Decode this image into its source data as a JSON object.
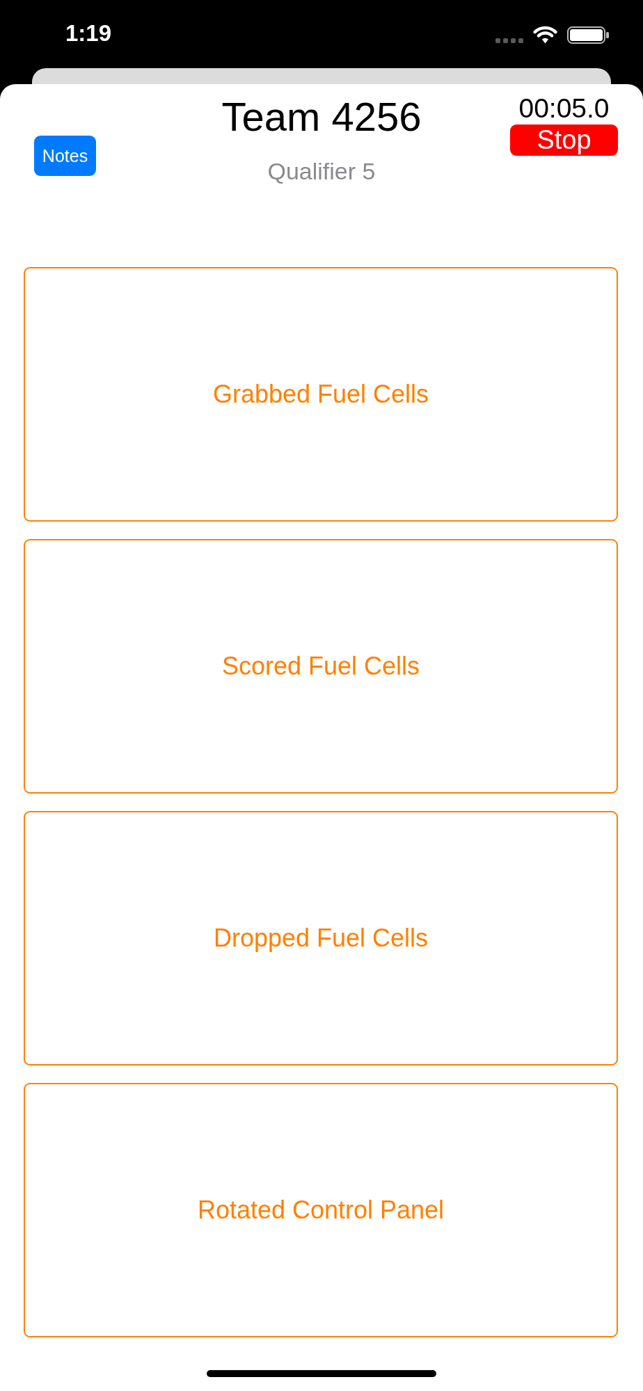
{
  "status_bar": {
    "time": "1:19"
  },
  "header": {
    "notes_button": "Notes",
    "title": "Team 4256",
    "subtitle": "Qualifier 5",
    "timer": "00:05.0",
    "stop_button": "Stop"
  },
  "actions": [
    {
      "label": "Grabbed Fuel Cells"
    },
    {
      "label": "Scored Fuel Cells"
    },
    {
      "label": "Dropped Fuel Cells"
    },
    {
      "label": "Rotated Control Panel"
    }
  ]
}
